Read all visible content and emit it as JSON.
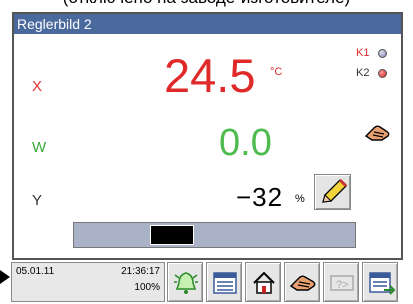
{
  "caption": "(отключено на заводе-изготовителе)",
  "window": {
    "title": "Reglerbild 2"
  },
  "x": {
    "label": "X",
    "value": "24.5",
    "unit": "°C"
  },
  "w": {
    "label": "W",
    "value": "0.0"
  },
  "y": {
    "label": "Y",
    "value": "−32",
    "unit": "%"
  },
  "contacts": [
    {
      "label": "K1",
      "state": "off",
      "color": "#8c8cc0"
    },
    {
      "label": "K2",
      "state": "on",
      "color": "#d22020"
    }
  ],
  "output_bar": {
    "level_percent": 32
  },
  "status": {
    "date": "05.01.11",
    "time": "21:36:17",
    "zoom": "100%"
  },
  "toolbar": {
    "buttons": [
      {
        "name": "alarm",
        "icon": "bell-icon"
      },
      {
        "name": "list",
        "icon": "list-icon"
      },
      {
        "name": "home",
        "icon": "house-icon"
      },
      {
        "name": "manual",
        "icon": "hand-icon"
      },
      {
        "name": "help",
        "icon": "help-icon",
        "enabled": false
      },
      {
        "name": "exit",
        "icon": "exit-icon"
      }
    ]
  },
  "colors": {
    "title_bar": "#4a6a9e",
    "x": "#e02a2a",
    "w": "#4dbb4d"
  }
}
